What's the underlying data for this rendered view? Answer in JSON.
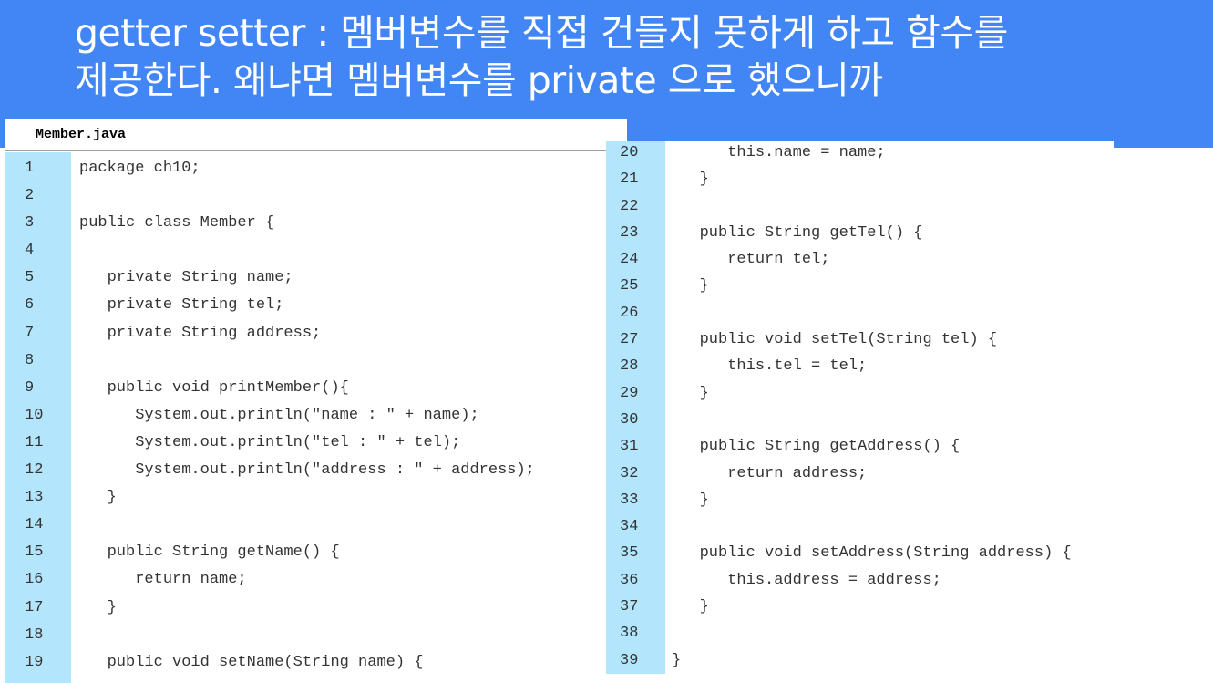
{
  "slide": {
    "title_line1": "getter setter : 멤버변수를 직접 건들지 못하게 하고 함수를",
    "title_line2": "제공한다. 왜냐면 멤버변수를 private 으로 했으니까"
  },
  "left_panel": {
    "filename": "Member.java",
    "lines": [
      {
        "n": "1",
        "code": "package ch10;"
      },
      {
        "n": "2",
        "code": ""
      },
      {
        "n": "3",
        "code": "public class Member {"
      },
      {
        "n": "4",
        "code": ""
      },
      {
        "n": "5",
        "code": "   private String name;"
      },
      {
        "n": "6",
        "code": "   private String tel;"
      },
      {
        "n": "7",
        "code": "   private String address;"
      },
      {
        "n": "8",
        "code": ""
      },
      {
        "n": "9",
        "code": "   public void printMember(){"
      },
      {
        "n": "10",
        "code": "      System.out.println(\"name : \" + name);"
      },
      {
        "n": "11",
        "code": "      System.out.println(\"tel : \" + tel);"
      },
      {
        "n": "12",
        "code": "      System.out.println(\"address : \" + address);"
      },
      {
        "n": "13",
        "code": "   }"
      },
      {
        "n": "14",
        "code": ""
      },
      {
        "n": "15",
        "code": "   public String getName() {"
      },
      {
        "n": "16",
        "code": "      return name;"
      },
      {
        "n": "17",
        "code": "   }"
      },
      {
        "n": "18",
        "code": ""
      },
      {
        "n": "19",
        "code": "   public void setName(String name) {"
      }
    ]
  },
  "right_panel": {
    "lines": [
      {
        "n": "20",
        "code": "      this.name = name;"
      },
      {
        "n": "21",
        "code": "   }"
      },
      {
        "n": "22",
        "code": ""
      },
      {
        "n": "23",
        "code": "   public String getTel() {"
      },
      {
        "n": "24",
        "code": "      return tel;"
      },
      {
        "n": "25",
        "code": "   }"
      },
      {
        "n": "26",
        "code": ""
      },
      {
        "n": "27",
        "code": "   public void setTel(String tel) {"
      },
      {
        "n": "28",
        "code": "      this.tel = tel;"
      },
      {
        "n": "29",
        "code": "   }"
      },
      {
        "n": "30",
        "code": ""
      },
      {
        "n": "31",
        "code": "   public String getAddress() {"
      },
      {
        "n": "32",
        "code": "      return address;"
      },
      {
        "n": "33",
        "code": "   }"
      },
      {
        "n": "34",
        "code": ""
      },
      {
        "n": "35",
        "code": "   public void setAddress(String address) {"
      },
      {
        "n": "36",
        "code": "      this.address = address;"
      },
      {
        "n": "37",
        "code": "   }"
      },
      {
        "n": "38",
        "code": ""
      },
      {
        "n": "39",
        "code": "}"
      }
    ]
  },
  "colors": {
    "header_bg": "#4285f4",
    "gutter_bg": "#b3e5fc",
    "code_text": "#333333"
  }
}
